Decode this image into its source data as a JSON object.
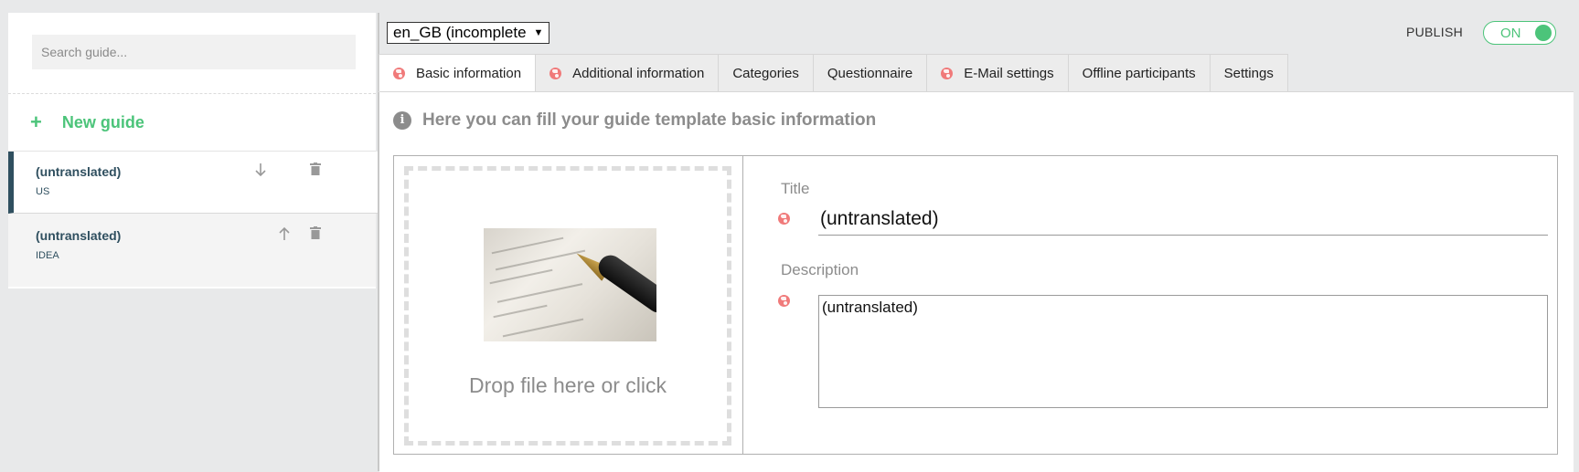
{
  "sidebar": {
    "search_placeholder": "Search guide...",
    "new_guide_label": "New guide",
    "items": [
      {
        "title": "(untranslated)",
        "subtitle": "US"
      },
      {
        "title": "(untranslated)",
        "subtitle": "IDEA"
      }
    ]
  },
  "header": {
    "language": "en_GB  (incomplete",
    "publish_label": "PUBLISH",
    "toggle_label": "ON"
  },
  "tabs": [
    {
      "label": "Basic information"
    },
    {
      "label": "Additional information"
    },
    {
      "label": "Categories"
    },
    {
      "label": "Questionnaire"
    },
    {
      "label": "E-Mail settings"
    },
    {
      "label": "Offline participants"
    },
    {
      "label": "Settings"
    }
  ],
  "main": {
    "info_text": "Here you can fill your guide template basic information",
    "dropzone_text": "Drop file here or click",
    "title_label": "Title",
    "title_value": "(untranslated)",
    "description_label": "Description",
    "description_value": "(untranslated)"
  },
  "colors": {
    "accent": "#4cc47a",
    "sidebar_text": "#2f4f5f",
    "globe": "#f07a7a"
  }
}
